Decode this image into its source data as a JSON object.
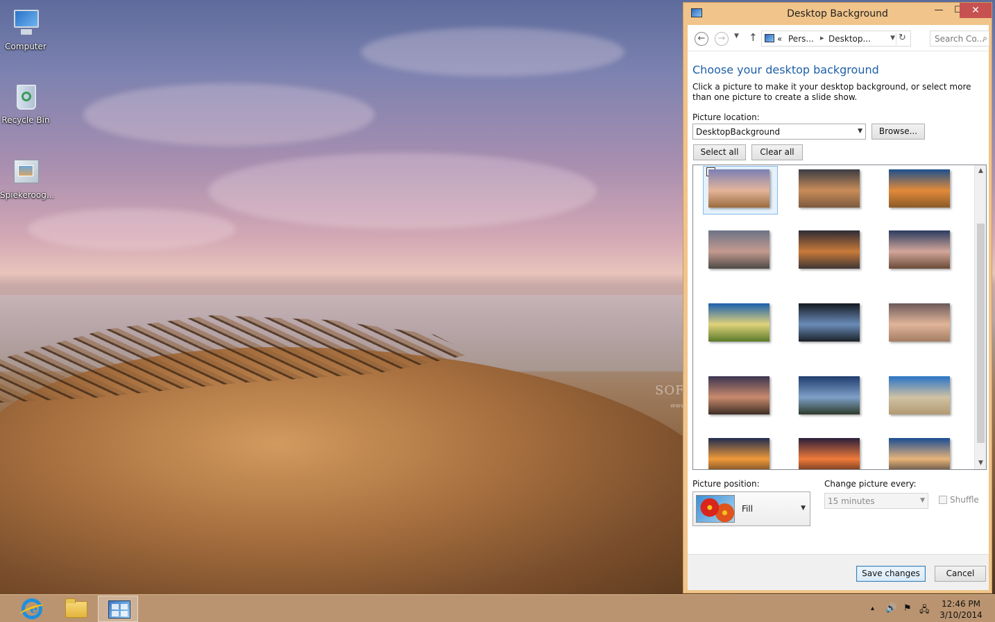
{
  "desktop": {
    "icons": [
      {
        "label": "Computer",
        "icon": "computer-icon"
      },
      {
        "label": "Recycle Bin",
        "icon": "recycle-bin-icon"
      },
      {
        "label": "Spiekeroog...",
        "icon": "package-icon"
      }
    ],
    "watermark": "SOFTPEDIA",
    "watermark_sub": "www.softpedia.com"
  },
  "window": {
    "title": "Desktop Background",
    "controls": {
      "minimize": "—",
      "maximize": "☐",
      "close": "✕"
    },
    "navbar": {
      "back_icon": "back-arrow-icon",
      "forward_icon": "forward-arrow-icon",
      "breadcrumb": [
        "«",
        "Pers...",
        "Desktop..."
      ],
      "search_placeholder": "Search Co..."
    },
    "heading": "Choose your desktop background",
    "description": "Click a picture to make it your desktop background, or select more than one picture to create a slide show.",
    "picture_location_label": "Picture location:",
    "picture_location_value": "DesktopBackground",
    "browse_label": "Browse...",
    "select_all_label": "Select all",
    "clear_all_label": "Clear all",
    "gallery": {
      "selected_index": 0,
      "thumbnails": [
        {
          "name": "sunset-rocks",
          "colors": [
            "#7b7fb5",
            "#e3b59a",
            "#9c6b3e"
          ]
        },
        {
          "name": "beach-hut",
          "colors": [
            "#3b3c44",
            "#c98c58",
            "#7b5a3e"
          ]
        },
        {
          "name": "dune-sunset-blue",
          "colors": [
            "#1d4f8c",
            "#e28a3a",
            "#8a5b28"
          ]
        },
        {
          "name": "foggy-dunes",
          "colors": [
            "#6d7387",
            "#c49a8f",
            "#4e4a46"
          ]
        },
        {
          "name": "calm-sea-sunset",
          "colors": [
            "#2d2b35",
            "#c97a3a",
            "#3f3633"
          ]
        },
        {
          "name": "rocky-shore",
          "colors": [
            "#2a3c60",
            "#d3a69a",
            "#6b4a38"
          ]
        },
        {
          "name": "green-dunes",
          "colors": [
            "#1b5fae",
            "#e0d27a",
            "#5a7a2a"
          ]
        },
        {
          "name": "night-sun",
          "colors": [
            "#151a22",
            "#6a8bb8",
            "#1a2228"
          ]
        },
        {
          "name": "beach-chair",
          "colors": [
            "#6d5a5a",
            "#e1b59a",
            "#a37d63"
          ]
        },
        {
          "name": "evening-cliffs",
          "colors": [
            "#3b3450",
            "#c98a6d",
            "#3d2d24"
          ]
        },
        {
          "name": "island-bay",
          "colors": [
            "#1f3c6e",
            "#7ea0c8",
            "#2d3a2a"
          ]
        },
        {
          "name": "sand-dune-day",
          "colors": [
            "#2a74c6",
            "#cfc2a4",
            "#b39a72"
          ]
        },
        {
          "name": "orange-horizon",
          "colors": [
            "#1f2b4e",
            "#f09a3a",
            "#4a3320"
          ]
        },
        {
          "name": "red-sunset",
          "colors": [
            "#2a1f3a",
            "#f07a3a",
            "#3a2018"
          ]
        },
        {
          "name": "blue-dusk",
          "colors": [
            "#1b4d93",
            "#e8b47a",
            "#2a2a30"
          ]
        }
      ]
    },
    "picture_position_label": "Picture position:",
    "picture_position_value": "Fill",
    "change_every_label": "Change picture every:",
    "change_every_value": "15 minutes",
    "shuffle_label": "Shuffle",
    "shuffle_checked": false,
    "save_label": "Save changes",
    "cancel_label": "Cancel"
  },
  "taskbar": {
    "apps": [
      {
        "name": "internet-explorer",
        "active": false
      },
      {
        "name": "file-explorer",
        "active": false
      },
      {
        "name": "control-panel",
        "active": true
      }
    ],
    "tray": {
      "show_hidden": "▴",
      "volume": "🔊",
      "flag": "⚑",
      "network": "🖧"
    },
    "time": "12:46 PM",
    "date": "3/10/2014"
  }
}
